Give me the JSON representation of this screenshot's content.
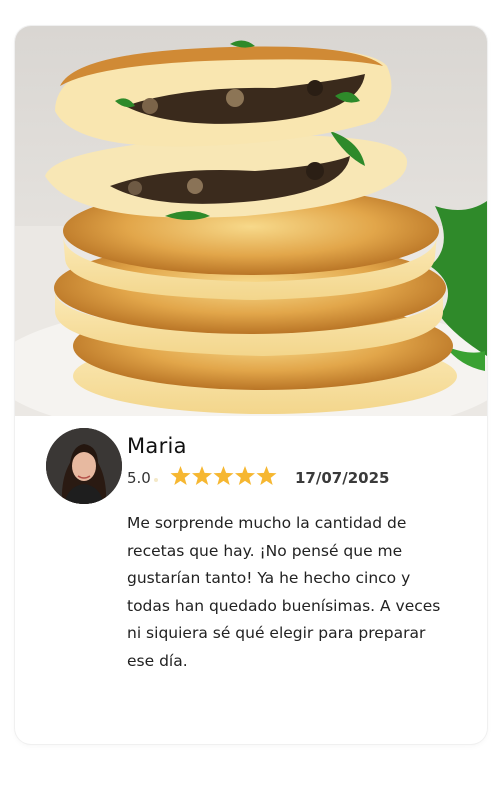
{
  "review_card": {
    "photo": {
      "alt": "Tortitas de patata rellenas de champiñones"
    },
    "reviewer": {
      "name": "Maria",
      "rating": 5.0,
      "rating_text": "5.0",
      "stars": 5,
      "date": "17/07/2025"
    },
    "review_text": "Me sorprende mucho la cantidad de recetas que hay. ¡No pensé que me gustarían tanto! Ya he hecho cinco y todas han quedado buenísimas. A veces ni siquiera sé qué elegir para preparar ese día."
  },
  "colors": {
    "star": "#f6b731",
    "text": "#222222",
    "date": "#3a3a3a"
  },
  "icons": [
    "star-icon"
  ]
}
